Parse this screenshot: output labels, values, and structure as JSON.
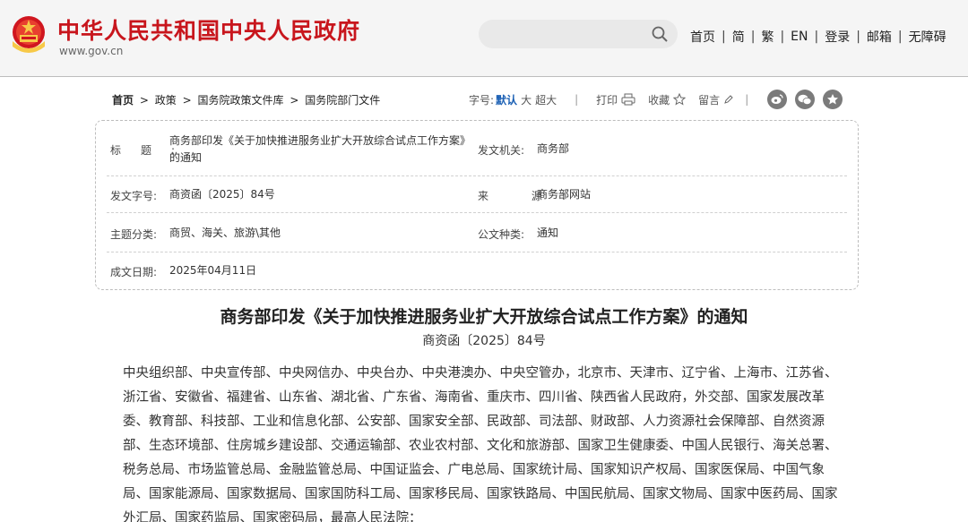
{
  "header": {
    "site_title": "中华人民共和国中央人民政府",
    "site_url": "www.gov.cn",
    "nav": [
      {
        "label": "首页"
      },
      {
        "label": "简"
      },
      {
        "label": "繁"
      },
      {
        "label": "EN"
      },
      {
        "label": "登录"
      },
      {
        "label": "邮箱"
      },
      {
        "label": "无障碍"
      }
    ]
  },
  "breadcrumb": {
    "items": [
      "首页",
      "政策",
      "国务院政策文件库",
      "国务院部门文件"
    ],
    "separator": ">"
  },
  "toolbar": {
    "font_size_label": "字号:",
    "font_default": "默认",
    "font_large": "大",
    "font_xlarge": "超大",
    "print_label": "打印",
    "favorite_label": "收藏",
    "comment_label": "留言",
    "divider": "|"
  },
  "info": {
    "title_label": "标题:",
    "title_value": "商务部印发《关于加快推进服务业扩大开放综合试点工作方案》的通知",
    "issuer_label": "发文机关:",
    "issuer_value": "商务部",
    "doc_no_label": "发文字号:",
    "doc_no_value": "商资函〔2025〕84号",
    "source_label": "来 源:",
    "source_value": "商务部网站",
    "category_label": "主题分类:",
    "category_value": "商贸、海关、旅游\\其他",
    "doc_type_label": "公文种类:",
    "doc_type_value": "通知",
    "date_label": "成文日期:",
    "date_value": "2025年04月11日"
  },
  "article": {
    "title": "商务部印发《关于加快推进服务业扩大开放综合试点工作方案》的通知",
    "doc_no": "商资函〔2025〕84号",
    "body": "中央组织部、中央宣传部、中央网信办、中央台办、中央港澳办、中央空管办，北京市、天津市、辽宁省、上海市、江苏省、浙江省、安徽省、福建省、山东省、湖北省、广东省、海南省、重庆市、四川省、陕西省人民政府，外交部、国家发展改革委、教育部、科技部、工业和信息化部、公安部、国家安全部、民政部、司法部、财政部、人力资源社会保障部、自然资源部、生态环境部、住房城乡建设部、交通运输部、农业农村部、文化和旅游部、国家卫生健康委、中国人民银行、海关总署、税务总局、市场监管总局、金融监管总局、中国证监会、广电总局、国家统计局、国家知识产权局、国家医保局、中国气象局、国家能源局、国家数据局、国家国防科工局、国家移民局、国家铁路局、中国民航局、国家文物局、国家中医药局、国家外汇局、国家药监局、国家密码局，最高人民法院："
  },
  "colors": {
    "brand_red": "#c8161d",
    "active_blue": "#1a5fb4",
    "header_bg": "#f5f5f5"
  },
  "icons": [
    "national-emblem-icon",
    "search-icon",
    "print-icon",
    "star-icon",
    "pencil-icon",
    "weibo-icon",
    "wechat-icon",
    "favorite-star-icon"
  ]
}
